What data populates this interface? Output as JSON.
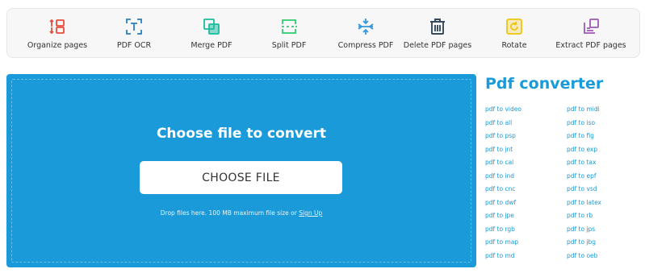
{
  "toolbar": {
    "tools": [
      {
        "label": "Organize pages",
        "icon": "organize-pages-icon",
        "color": "#e74c3c"
      },
      {
        "label": "PDF OCR",
        "icon": "ocr-icon",
        "color": "#2980b9"
      },
      {
        "label": "Merge PDF",
        "icon": "merge-icon",
        "color": "#1abc9c"
      },
      {
        "label": "Split PDF",
        "icon": "split-icon",
        "color": "#2ecc71"
      },
      {
        "label": "Compress PDF",
        "icon": "compress-icon",
        "color": "#3498db"
      },
      {
        "label": "Delete PDF pages",
        "icon": "trash-icon",
        "color": "#34495e"
      },
      {
        "label": "Rotate",
        "icon": "rotate-icon",
        "color": "#f1c40f"
      },
      {
        "label": "Extract PDF pages",
        "icon": "extract-icon",
        "color": "#9b59b6"
      }
    ]
  },
  "upload": {
    "heading": "Choose file to convert",
    "button_label": "CHOOSE FILE",
    "hint": "Drop files here. 100 MB maximum file size or",
    "signup_link": "Sign Up",
    "background": "#1a9ad8"
  },
  "converter": {
    "title": "Pdf converter",
    "left_links": [
      "pdf to video",
      "pdf to all",
      "pdf to psp",
      "pdf to jnt",
      "pdf to cal",
      "pdf to ind",
      "pdf to cnc",
      "pdf to dwf",
      "pdf to jpe",
      "pdf to rgb",
      "pdf to map",
      "pdf to md"
    ],
    "right_links": [
      "pdf to midi",
      "pdf to iso",
      "pdf to fig",
      "pdf to exp",
      "pdf to tax",
      "pdf to epf",
      "pdf to vsd",
      "pdf to latex",
      "pdf to rb",
      "pdf to jps",
      "pdf to jbg",
      "pdf to oeb"
    ]
  }
}
